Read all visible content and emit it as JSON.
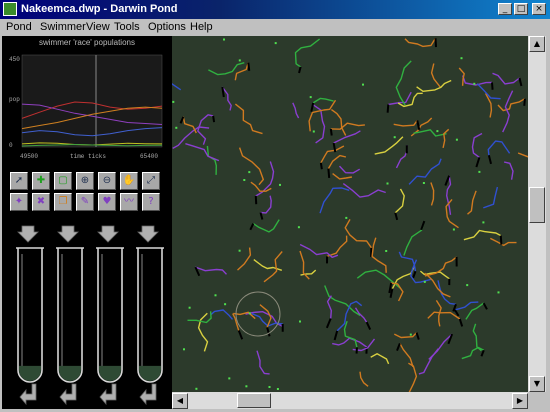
{
  "window": {
    "title": "Nakeemca.dwp - Darwin Pond",
    "controls": {
      "minimize": "_",
      "maximize": "□",
      "close": "×"
    }
  },
  "menu": [
    {
      "label": "Pond"
    },
    {
      "label": "Swimmer"
    },
    {
      "label": "View"
    },
    {
      "label": "Tools"
    },
    {
      "label": "Options"
    },
    {
      "label": "Help"
    }
  ],
  "graph": {
    "title": "swimmer 'race' populations",
    "y_axis_label": "pop",
    "y_ticks": [
      "450",
      "0"
    ],
    "x_start": "49500",
    "x_label": "time ticks",
    "x_end": "65400"
  },
  "chart_data": {
    "type": "line",
    "title": "swimmer 'race' populations",
    "xlabel": "time ticks",
    "ylabel": "pop",
    "xlim": [
      49500,
      65400
    ],
    "ylim": [
      0,
      450
    ],
    "x": [
      49500,
      51500,
      53500,
      55500,
      57500,
      59500,
      61500,
      63500,
      65400
    ],
    "series": [
      {
        "color": "#c03030",
        "values": [
          140,
          170,
          200,
          220,
          215,
          195,
          185,
          190,
          200
        ]
      },
      {
        "color": "#9040c0",
        "values": [
          210,
          205,
          185,
          165,
          150,
          135,
          120,
          115,
          110
        ]
      },
      {
        "color": "#d08020",
        "values": [
          90,
          105,
          120,
          140,
          160,
          175,
          190,
          195,
          190
        ]
      },
      {
        "color": "#4060d0",
        "values": [
          70,
          80,
          75,
          60,
          55,
          65,
          80,
          90,
          95
        ]
      },
      {
        "color": "#c0c020",
        "values": [
          15,
          20,
          18,
          12,
          10,
          14,
          18,
          16,
          15
        ]
      },
      {
        "color": "#40a040",
        "values": [
          5,
          8,
          10,
          12,
          10,
          8,
          6,
          8,
          9
        ]
      }
    ]
  },
  "tools": [
    {
      "icon": "arrow-pointer-icon"
    },
    {
      "icon": "add-swimmer-icon"
    },
    {
      "icon": "select-box-icon"
    },
    {
      "icon": "zoom-in-icon"
    },
    {
      "icon": "zoom-out-icon"
    },
    {
      "icon": "hand-icon"
    },
    {
      "icon": "fit-view-icon"
    },
    {
      "icon": "feed-icon"
    },
    {
      "icon": "kill-icon"
    },
    {
      "icon": "copy-icon"
    },
    {
      "icon": "edit-genes-icon"
    },
    {
      "icon": "mate-icon"
    },
    {
      "icon": "tail-icon"
    },
    {
      "icon": "help-icon"
    }
  ],
  "tubes": [
    {
      "fill": 0.12
    },
    {
      "fill": 0.12
    },
    {
      "fill": 0.12
    },
    {
      "fill": 0.12
    }
  ],
  "colors": {
    "pond_bg": "#2c3a2b",
    "orange": "#d07a20",
    "purple": "#8a3fd0",
    "blue": "#3050d0",
    "green": "#30b040",
    "yellow": "#d8d040",
    "black": "#000000"
  },
  "scrollbars": {
    "vertical_position": 0.47,
    "horizontal_position": 0.17
  }
}
